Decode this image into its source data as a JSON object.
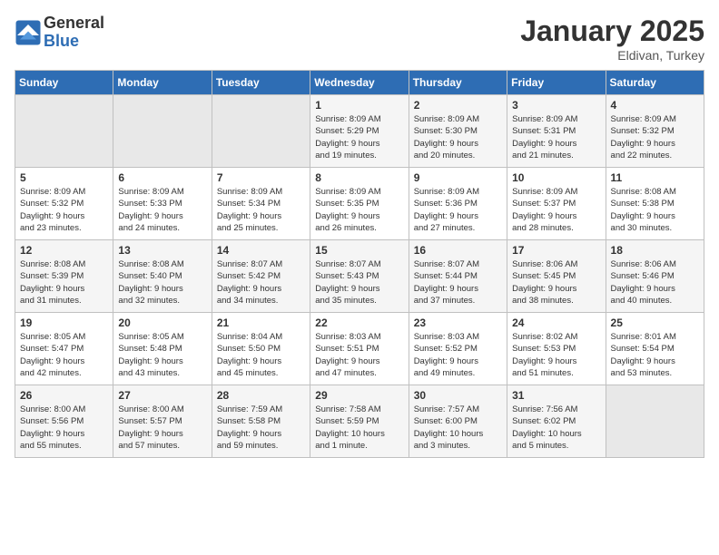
{
  "logo": {
    "general": "General",
    "blue": "Blue"
  },
  "header": {
    "month": "January 2025",
    "location": "Eldivan, Turkey"
  },
  "weekdays": [
    "Sunday",
    "Monday",
    "Tuesday",
    "Wednesday",
    "Thursday",
    "Friday",
    "Saturday"
  ],
  "weeks": [
    [
      {
        "day": "",
        "info": ""
      },
      {
        "day": "",
        "info": ""
      },
      {
        "day": "",
        "info": ""
      },
      {
        "day": "1",
        "info": "Sunrise: 8:09 AM\nSunset: 5:29 PM\nDaylight: 9 hours\nand 19 minutes."
      },
      {
        "day": "2",
        "info": "Sunrise: 8:09 AM\nSunset: 5:30 PM\nDaylight: 9 hours\nand 20 minutes."
      },
      {
        "day": "3",
        "info": "Sunrise: 8:09 AM\nSunset: 5:31 PM\nDaylight: 9 hours\nand 21 minutes."
      },
      {
        "day": "4",
        "info": "Sunrise: 8:09 AM\nSunset: 5:32 PM\nDaylight: 9 hours\nand 22 minutes."
      }
    ],
    [
      {
        "day": "5",
        "info": "Sunrise: 8:09 AM\nSunset: 5:32 PM\nDaylight: 9 hours\nand 23 minutes."
      },
      {
        "day": "6",
        "info": "Sunrise: 8:09 AM\nSunset: 5:33 PM\nDaylight: 9 hours\nand 24 minutes."
      },
      {
        "day": "7",
        "info": "Sunrise: 8:09 AM\nSunset: 5:34 PM\nDaylight: 9 hours\nand 25 minutes."
      },
      {
        "day": "8",
        "info": "Sunrise: 8:09 AM\nSunset: 5:35 PM\nDaylight: 9 hours\nand 26 minutes."
      },
      {
        "day": "9",
        "info": "Sunrise: 8:09 AM\nSunset: 5:36 PM\nDaylight: 9 hours\nand 27 minutes."
      },
      {
        "day": "10",
        "info": "Sunrise: 8:09 AM\nSunset: 5:37 PM\nDaylight: 9 hours\nand 28 minutes."
      },
      {
        "day": "11",
        "info": "Sunrise: 8:08 AM\nSunset: 5:38 PM\nDaylight: 9 hours\nand 30 minutes."
      }
    ],
    [
      {
        "day": "12",
        "info": "Sunrise: 8:08 AM\nSunset: 5:39 PM\nDaylight: 9 hours\nand 31 minutes."
      },
      {
        "day": "13",
        "info": "Sunrise: 8:08 AM\nSunset: 5:40 PM\nDaylight: 9 hours\nand 32 minutes."
      },
      {
        "day": "14",
        "info": "Sunrise: 8:07 AM\nSunset: 5:42 PM\nDaylight: 9 hours\nand 34 minutes."
      },
      {
        "day": "15",
        "info": "Sunrise: 8:07 AM\nSunset: 5:43 PM\nDaylight: 9 hours\nand 35 minutes."
      },
      {
        "day": "16",
        "info": "Sunrise: 8:07 AM\nSunset: 5:44 PM\nDaylight: 9 hours\nand 37 minutes."
      },
      {
        "day": "17",
        "info": "Sunrise: 8:06 AM\nSunset: 5:45 PM\nDaylight: 9 hours\nand 38 minutes."
      },
      {
        "day": "18",
        "info": "Sunrise: 8:06 AM\nSunset: 5:46 PM\nDaylight: 9 hours\nand 40 minutes."
      }
    ],
    [
      {
        "day": "19",
        "info": "Sunrise: 8:05 AM\nSunset: 5:47 PM\nDaylight: 9 hours\nand 42 minutes."
      },
      {
        "day": "20",
        "info": "Sunrise: 8:05 AM\nSunset: 5:48 PM\nDaylight: 9 hours\nand 43 minutes."
      },
      {
        "day": "21",
        "info": "Sunrise: 8:04 AM\nSunset: 5:50 PM\nDaylight: 9 hours\nand 45 minutes."
      },
      {
        "day": "22",
        "info": "Sunrise: 8:03 AM\nSunset: 5:51 PM\nDaylight: 9 hours\nand 47 minutes."
      },
      {
        "day": "23",
        "info": "Sunrise: 8:03 AM\nSunset: 5:52 PM\nDaylight: 9 hours\nand 49 minutes."
      },
      {
        "day": "24",
        "info": "Sunrise: 8:02 AM\nSunset: 5:53 PM\nDaylight: 9 hours\nand 51 minutes."
      },
      {
        "day": "25",
        "info": "Sunrise: 8:01 AM\nSunset: 5:54 PM\nDaylight: 9 hours\nand 53 minutes."
      }
    ],
    [
      {
        "day": "26",
        "info": "Sunrise: 8:00 AM\nSunset: 5:56 PM\nDaylight: 9 hours\nand 55 minutes."
      },
      {
        "day": "27",
        "info": "Sunrise: 8:00 AM\nSunset: 5:57 PM\nDaylight: 9 hours\nand 57 minutes."
      },
      {
        "day": "28",
        "info": "Sunrise: 7:59 AM\nSunset: 5:58 PM\nDaylight: 9 hours\nand 59 minutes."
      },
      {
        "day": "29",
        "info": "Sunrise: 7:58 AM\nSunset: 5:59 PM\nDaylight: 10 hours\nand 1 minute."
      },
      {
        "day": "30",
        "info": "Sunrise: 7:57 AM\nSunset: 6:00 PM\nDaylight: 10 hours\nand 3 minutes."
      },
      {
        "day": "31",
        "info": "Sunrise: 7:56 AM\nSunset: 6:02 PM\nDaylight: 10 hours\nand 5 minutes."
      },
      {
        "day": "",
        "info": ""
      }
    ]
  ]
}
